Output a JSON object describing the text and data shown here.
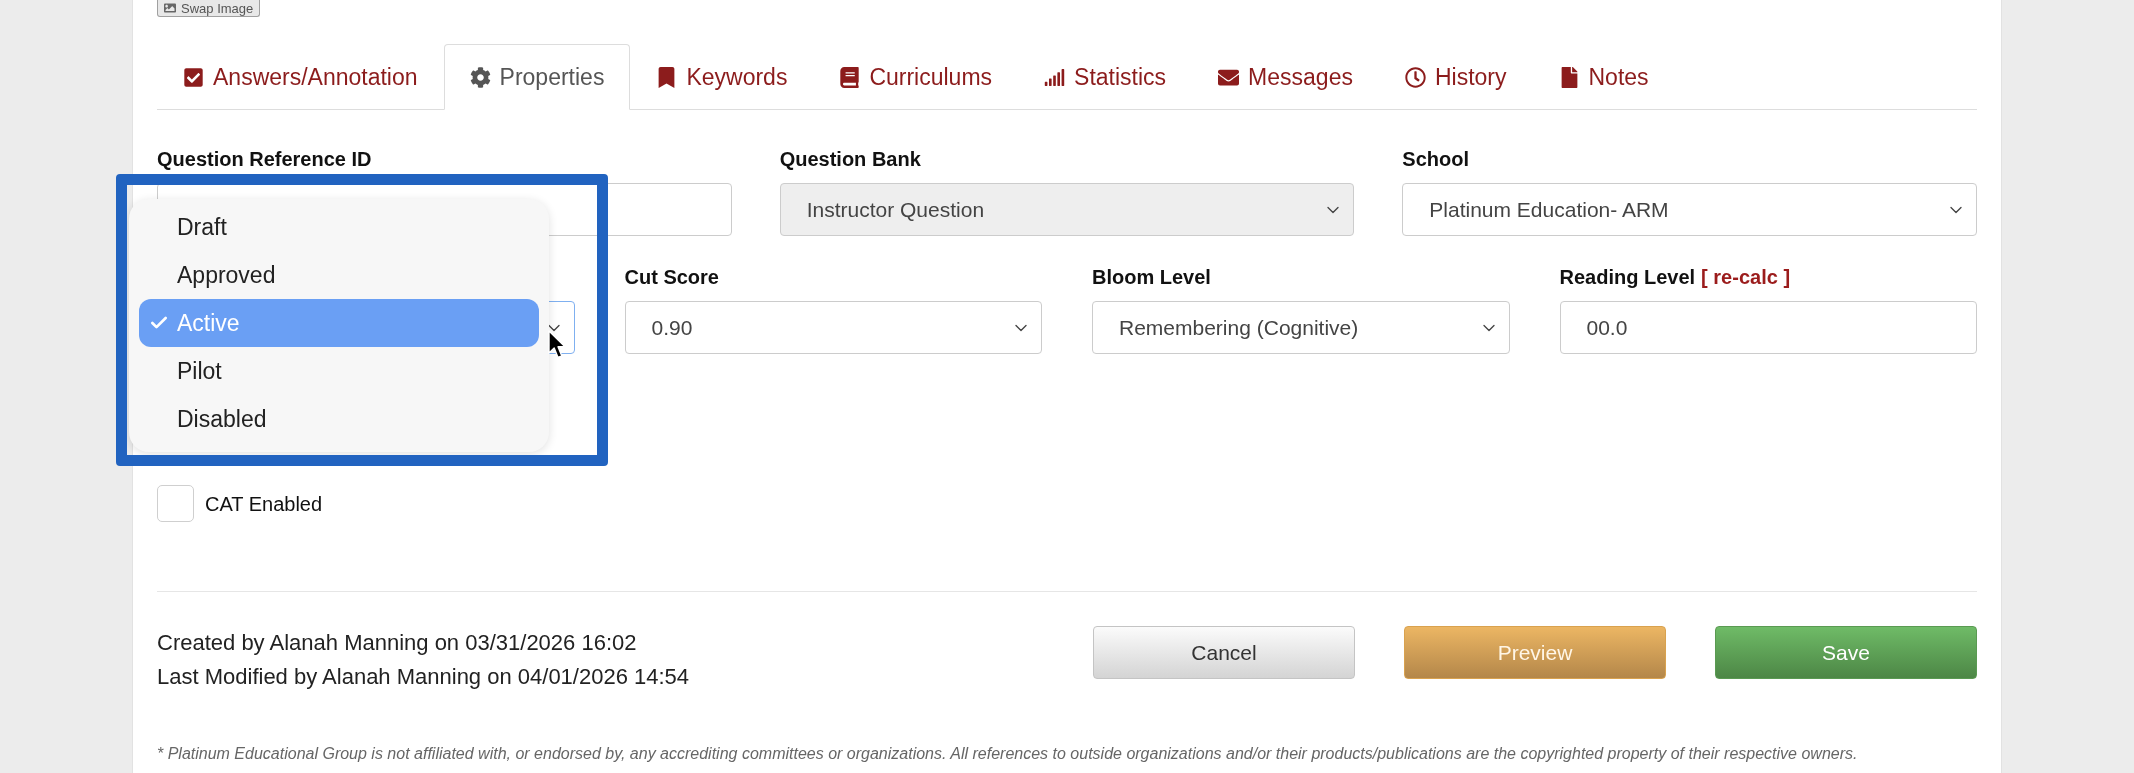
{
  "swap_image_button": {
    "label": "Swap Image"
  },
  "tabs": [
    {
      "label": "Answers/Annotation",
      "selected": false
    },
    {
      "label": "Properties",
      "selected": true
    },
    {
      "label": "Keywords",
      "selected": false
    },
    {
      "label": "Curriculums",
      "selected": false
    },
    {
      "label": "Statistics",
      "selected": false
    },
    {
      "label": "Messages",
      "selected": false
    },
    {
      "label": "History",
      "selected": false
    },
    {
      "label": "Notes",
      "selected": false
    }
  ],
  "form_row_1": [
    {
      "kind": "text",
      "label": "Question Reference ID",
      "disabled": false
    },
    {
      "kind": "select",
      "label": "Question Bank",
      "value": "Instructor Question",
      "disabled": true
    },
    {
      "kind": "select",
      "label": "School",
      "value": "Platinum Education- ARM",
      "disabled": false
    }
  ],
  "form_row_2": [
    {
      "kind": "select",
      "focused": true
    },
    {
      "kind": "select",
      "label": "Cut Score",
      "value": "0.90",
      "focused": false
    },
    {
      "kind": "select",
      "label": "Bloom Level",
      "value": "Remembering (Cognitive)",
      "focused": false
    },
    {
      "kind": "text",
      "label": "Reading Level",
      "label_link": "[ re-calc ]",
      "value": "00.0",
      "focused": false
    }
  ],
  "status_dropdown": {
    "options": [
      {
        "label": "Draft",
        "selected": false
      },
      {
        "label": "Approved",
        "selected": false
      },
      {
        "label": "Active",
        "selected": true
      },
      {
        "label": "Pilot",
        "selected": false
      },
      {
        "label": "Disabled",
        "selected": false
      }
    ]
  },
  "cat_enabled": {
    "label": "CAT Enabled",
    "checked": false
  },
  "audit_lines": [
    "Created by Alanah Manning on 03/31/2026 16:02",
    "Last Modified by Alanah Manning on 04/01/2026 14:54"
  ],
  "buttons": [
    {
      "label": "Cancel",
      "kind": "default"
    },
    {
      "label": "Preview",
      "kind": "warning"
    },
    {
      "label": "Save",
      "kind": "success"
    }
  ],
  "footnote": "* Platinum Educational Group is not affiliated with, or endorsed by, any accrediting committees or organizations. All references to outside organizations and/or their products/publications are the copyrighted property of their respective owners."
}
